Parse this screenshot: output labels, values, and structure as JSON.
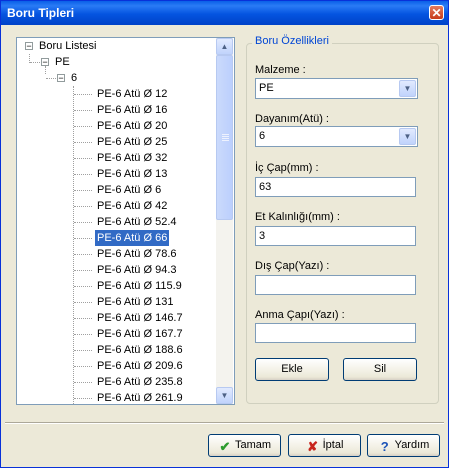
{
  "window": {
    "title": "Boru Tipleri",
    "close_glyph": "✕"
  },
  "tree": {
    "root": "Boru Listesi",
    "material": "PE",
    "pressure": "6",
    "items": [
      "PE-6 Atü Ø 12",
      "PE-6 Atü Ø 16",
      "PE-6 Atü Ø 20",
      "PE-6 Atü Ø 25",
      "PE-6 Atü Ø 32",
      "PE-6 Atü Ø 13",
      "PE-6 Atü Ø 6",
      "PE-6 Atü Ø 42",
      "PE-6 Atü Ø 52.4",
      "PE-6 Atü Ø 66",
      "PE-6 Atü Ø 78.6",
      "PE-6 Atü Ø 94.3",
      "PE-6 Atü Ø 115.9",
      "PE-6 Atü Ø 131",
      "PE-6 Atü Ø 146.7",
      "PE-6 Atü Ø 167.7",
      "PE-6 Atü Ø 188.6",
      "PE-6 Atü Ø 209.6",
      "PE-6 Atü Ø 235.8",
      "PE-6 Atü Ø 261.9"
    ],
    "selected_item": "PE-6 Atü Ø 66"
  },
  "properties": {
    "title": "Boru Özellikleri",
    "material_label": "Malzeme :",
    "material_value": "PE",
    "pressure_label": "Dayanım(Atü) :",
    "pressure_value": "6",
    "inner_diameter_label": "İç Çap(mm) :",
    "inner_diameter_value": "63",
    "wall_thickness_label": "Et Kalınlığı(mm) :",
    "wall_thickness_value": "3",
    "outer_diameter_label": "Dış Çap(Yazı) :",
    "outer_diameter_value": "",
    "nominal_diameter_label": "Anma Çapı(Yazı) :",
    "nominal_diameter_value": "",
    "add_label": "Ekle",
    "delete_label": "Sil"
  },
  "footer": {
    "ok_label": "Tamam",
    "cancel_label": "İptal",
    "help_label": "Yardım"
  },
  "colors": {
    "selection": "#316ac5",
    "titlebar": "#0454e0",
    "group_title": "#0046d5",
    "ok_icon": "#2d9b2d",
    "cancel_icon": "#c8251c",
    "help_icon": "#1c53b8"
  }
}
